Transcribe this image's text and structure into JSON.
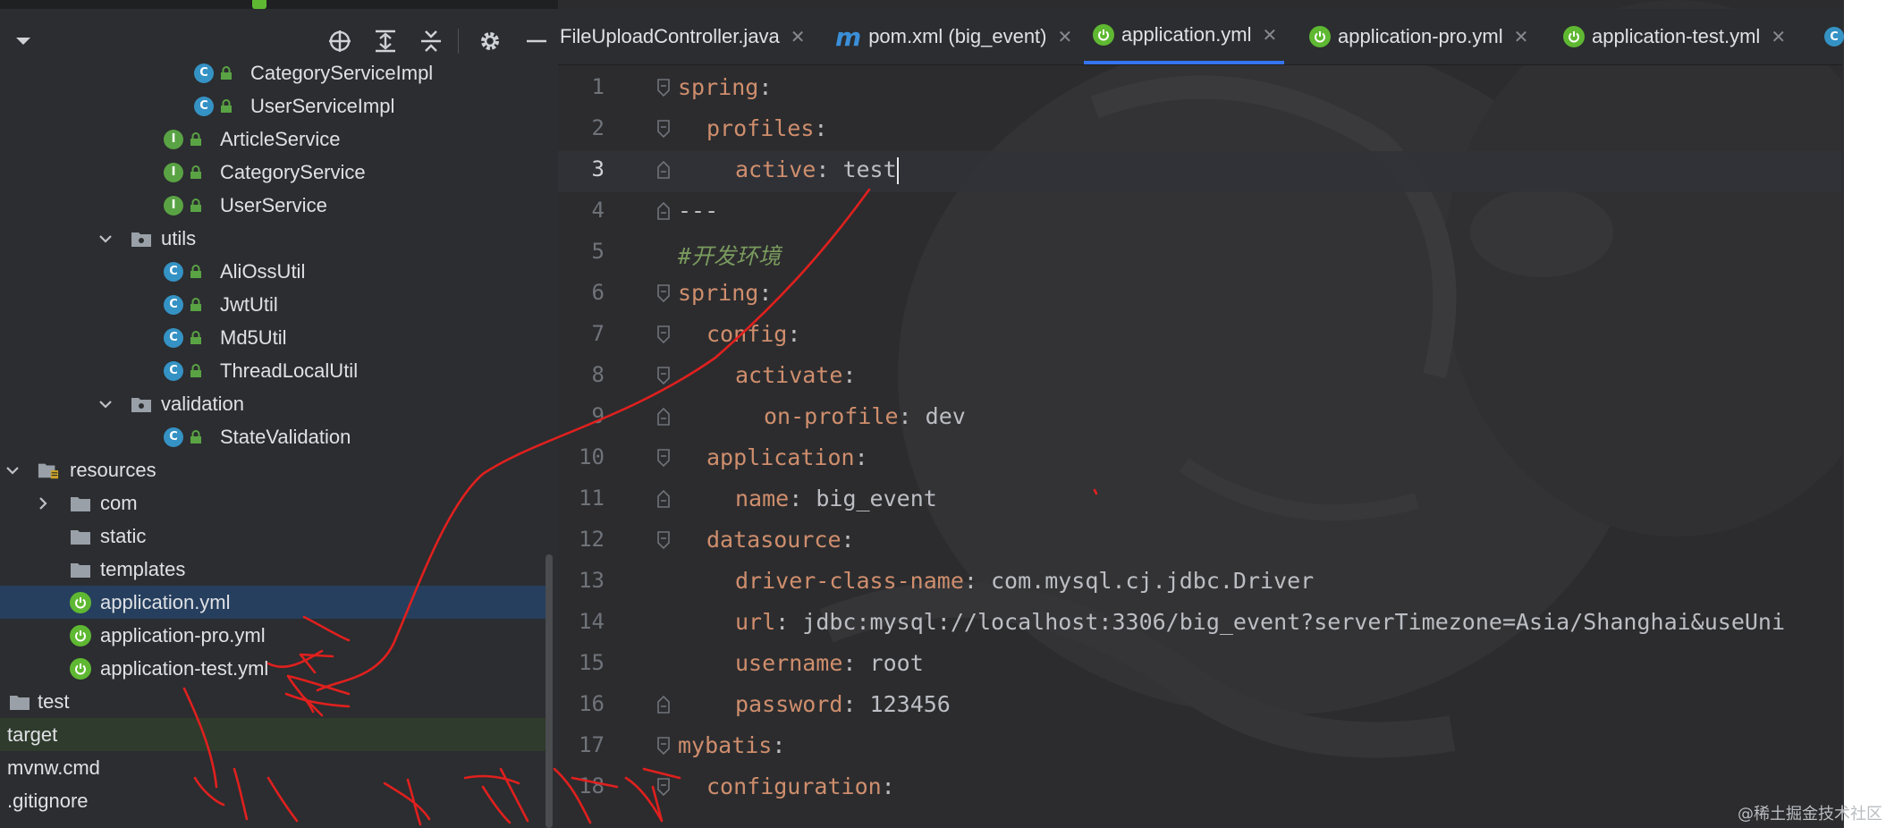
{
  "toolbar": {
    "locate_icon": "crosshair-icon",
    "expand_icon": "expand-all-icon",
    "collapse_icon": "collapse-all-icon",
    "settings_icon": "gear-icon",
    "hide_icon": "minus-icon"
  },
  "tree": {
    "CategoryServiceImpl": "CategoryServiceImpl",
    "UserServiceImpl": "UserServiceImpl",
    "ArticleService": "ArticleService",
    "CategoryService": "CategoryService",
    "UserService": "UserService",
    "utils": "utils",
    "AliOssUtil": "AliOssUtil",
    "JwtUtil": "JwtUtil",
    "Md5Util": "Md5Util",
    "ThreadLocalUtil": "ThreadLocalUtil",
    "validation": "validation",
    "StateValidation": "StateValidation",
    "resources": "resources",
    "com": "com",
    "static": "static",
    "templates": "templates",
    "application_yml": "application.yml",
    "application_pro_yml": "application-pro.yml",
    "application_test_yml": "application-test.yml",
    "test": "test",
    "target": "target",
    "mvnw_cmd": "mvnw.cmd",
    "gitignore": ".gitignore"
  },
  "tabs": {
    "t1": "FileUploadController.java",
    "t2": "pom.xml (big_event)",
    "t3": "application.yml",
    "t4": "application-pro.yml",
    "t5": "application-test.yml",
    "close": "✕",
    "mvn_glyph": "m",
    "active": "application.yml"
  },
  "code": {
    "n1": "1",
    "n2": "2",
    "n3": "3",
    "n4": "4",
    "n5": "5",
    "n6": "6",
    "n7": "7",
    "n8": "8",
    "n9": "9",
    "n10": "10",
    "n11": "11",
    "n12": "12",
    "n13": "13",
    "n14": "14",
    "n15": "15",
    "n16": "16",
    "n17": "17",
    "n18": "18",
    "l1k": "spring",
    "colon": ":",
    "l2k": "profiles",
    "l3k": "active",
    "l3v": "test",
    "l4": "---",
    "l5": "#开发环境",
    "l6k": "spring",
    "l7k": "config",
    "l8k": "activate",
    "l9k": "on-profile",
    "l9v": "dev",
    "l10k": "application",
    "l11k": "name",
    "l11v": "big_event",
    "l12k": "datasource",
    "l13k": "driver-class-name",
    "l13v": "com.mysql.cj.jdbc.Driver",
    "l14k": "url",
    "l14v": "jdbc:mysql://localhost:3306/big_event?serverTimezone=Asia/Shanghai&useUni",
    "l15k": "username",
    "l15v": "root",
    "l16k": "password",
    "l16v": "123456",
    "l17k": "mybatis",
    "l18k": "configuration"
  },
  "watermark": "@稀土掘金技术社区",
  "colors": {
    "keyword": "#cf8e6d",
    "comment": "#7a9a5e",
    "selection": "#263f5e",
    "spring_green": "#5fb832",
    "class_blue": "#3592c4",
    "annotation_red": "#e0201e"
  }
}
